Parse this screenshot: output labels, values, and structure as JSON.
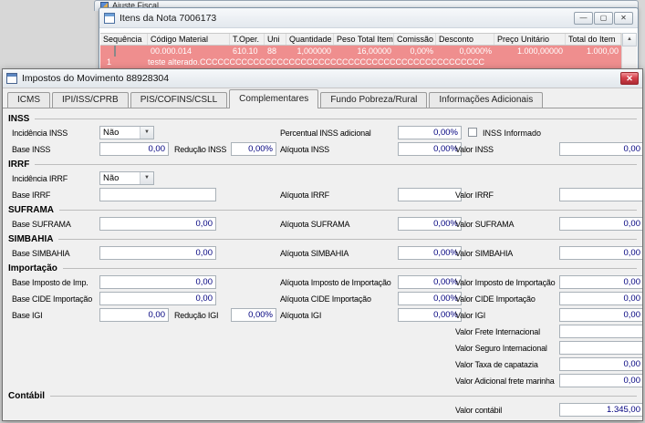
{
  "icons": {
    "dropdown": "▼",
    "scroll_up": "▲",
    "minimize": "—",
    "maximize": "▢",
    "close": "✕"
  },
  "fragment": {
    "title": "Ajuste Fiscal"
  },
  "items_window": {
    "title": "Itens da Nota 7006173",
    "grid": {
      "columns": [
        "Sequência",
        "Código Material",
        "T.Oper.",
        "Uni",
        "Quantidade",
        "Peso Total Item",
        "Comissão",
        "Desconto",
        "Preço Unitário",
        "Total do Item"
      ],
      "row": {
        "seq": "1",
        "cells": [
          "00.000.014",
          "610.10",
          "88",
          "1,000000",
          "16,00000",
          "0,00%",
          "0,0000%",
          "1.000,00000",
          "1.000,00"
        ],
        "description": "teste alterado.CCCCCCCCCCCCCCCCCCCCCCCCCCCCCCCCCCCCCCCCCCCCCCCC"
      }
    }
  },
  "dialog": {
    "title": "Impostos do Movimento 88928304",
    "tabs": [
      "ICMS",
      "IPI/ISS/CPRB",
      "PIS/COFINS/CSLL",
      "Complementares",
      "Fundo Pobreza/Rural",
      "Informações Adicionais"
    ],
    "active_tab": "Complementares",
    "inss": {
      "title": "INSS",
      "incidencia": {
        "label": "Incidência INSS",
        "value": "Não"
      },
      "percentual_adicional": {
        "label": "Percentual INSS adicional",
        "value": "0,00%"
      },
      "informado": {
        "label": "INSS Informado",
        "checked": false
      },
      "base": {
        "label": "Base INSS",
        "value": "0,00"
      },
      "reducao": {
        "label": "Redução INSS",
        "value": "0,00%"
      },
      "aliquota": {
        "label": "Alíquota INSS",
        "value": "0,00%"
      },
      "valor": {
        "label": "Valor INSS",
        "value": "0,00"
      }
    },
    "irrf": {
      "title": "IRRF",
      "incidencia": {
        "label": "Incidência IRRF",
        "value": "Não"
      },
      "base": {
        "label": "Base IRRF",
        "value": ""
      },
      "aliquota": {
        "label": "Alíquota IRRF",
        "value": ""
      },
      "valor": {
        "label": "Valor IRRF",
        "value": ""
      }
    },
    "suframa": {
      "title": "SUFRAMA",
      "base": {
        "label": "Base SUFRAMA",
        "value": "0,00"
      },
      "aliquota": {
        "label": "Alíquota SUFRAMA",
        "value": "0,00%"
      },
      "valor": {
        "label": "Valor SUFRAMA",
        "value": "0,00"
      }
    },
    "simbahia": {
      "title": "SIMBAHIA",
      "base": {
        "label": "Base SIMBAHIA",
        "value": "0,00"
      },
      "aliquota": {
        "label": "Alíquota SIMBAHIA",
        "value": "0,00%"
      },
      "valor": {
        "label": "Valor SIMBAHIA",
        "value": "0,00"
      }
    },
    "importacao": {
      "title": "Importação",
      "base_imposto": {
        "label": "Base Imposto de Imp.",
        "value": "0,00"
      },
      "aliquota_imposto": {
        "label": "Alíquota Imposto de Importação",
        "value": "0,00%"
      },
      "valor_imposto": {
        "label": "Valor Imposto de Importação",
        "value": "0,00"
      },
      "base_cide": {
        "label": "Base CIDE Importação",
        "value": "0,00"
      },
      "aliquota_cide": {
        "label": "Alíquota CIDE Importação",
        "value": "0,00%"
      },
      "valor_cide": {
        "label": "Valor CIDE Importação",
        "value": "0,00"
      },
      "base_igi": {
        "label": "Base IGI",
        "value": "0,00"
      },
      "reducao_igi": {
        "label": "Redução IGI",
        "value": "0,00%"
      },
      "aliquota_igi": {
        "label": "Alíquota IGI",
        "value": "0,00%"
      },
      "valor_igi": {
        "label": "Valor IGI",
        "value": "0,00"
      },
      "frete": {
        "label": "Valor Frete Internacional",
        "value": ""
      },
      "seguro": {
        "label": "Valor Seguro Internacional",
        "value": ""
      },
      "capatazia": {
        "label": "Valor Taxa de capatazia",
        "value": "0,00"
      },
      "adicional_frete": {
        "label": "Valor Adicional frete marinha",
        "value": "0,00"
      }
    },
    "contabil": {
      "title": "Contábil",
      "valor": {
        "label": "Valor contábil",
        "value": "1.345,00"
      }
    }
  }
}
